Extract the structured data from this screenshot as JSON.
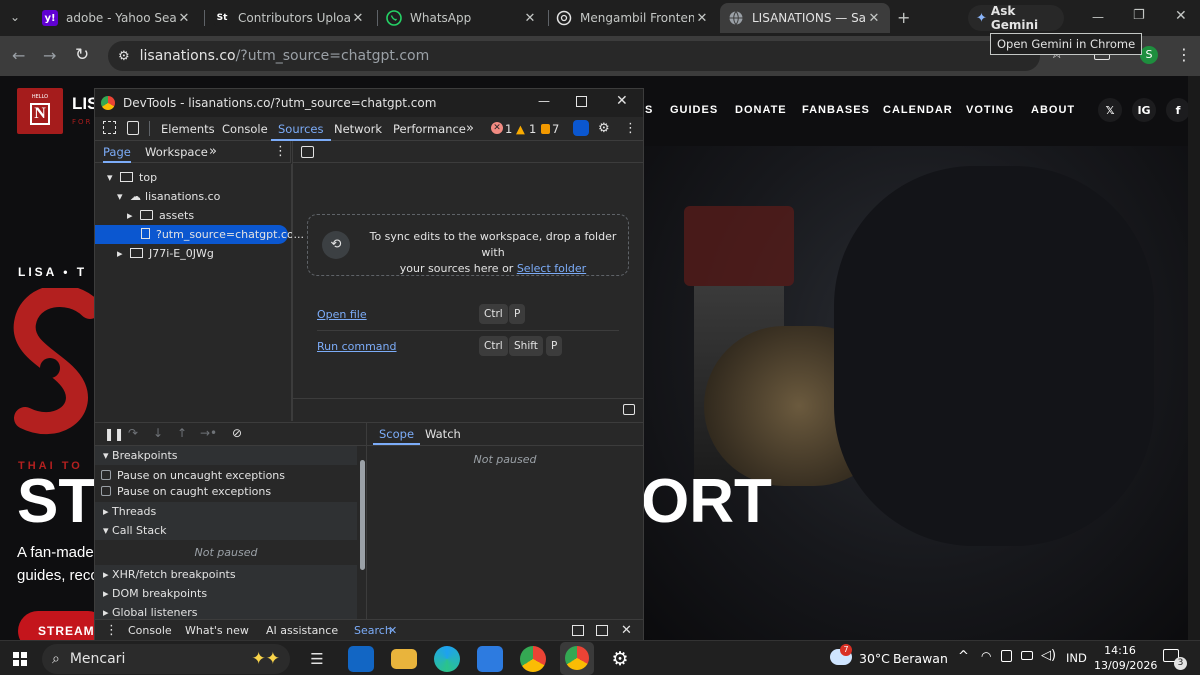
{
  "browser": {
    "tabs": [
      {
        "title": "adobe - Yahoo Search R",
        "favicon_text": "y!",
        "favicon_color": "#6001d2"
      },
      {
        "title": "Contributors Upload Fil",
        "favicon_text": "St",
        "favicon_color": "#1f1f1f"
      },
      {
        "title": "WhatsApp",
        "favicon_color": "#25d366"
      },
      {
        "title": "Mengambil Frontend Ke",
        "favicon_color": "#e3e3e3"
      },
      {
        "title": "LISANATIONS — SaWaD",
        "favicon_color": "#9aa0a6"
      }
    ],
    "ask_gemini": "Ask Gemini",
    "tooltip": "Open Gemini in Chrome",
    "url_host": "lisanations.co",
    "url_path": "/?utm_source=chatgpt.com",
    "profile_initial": "S"
  },
  "site": {
    "logo_small": "HELLO",
    "brand_partial": "LIS",
    "brand_sub_partial": "FOR",
    "nav": [
      "S",
      "GUIDES",
      "DONATE",
      "FANBASES",
      "CALENDAR",
      "VOTING",
      "ABOUT"
    ],
    "social": [
      "𝕏",
      "IG",
      "f"
    ],
    "kicker_partial": "LISA • T",
    "subkicker": "THAI TO",
    "headline_left": "ST",
    "headline_right": "ORT",
    "desc_line1": "A fan-made",
    "desc_line2": "guides, reco",
    "cta_partial": "STREAM"
  },
  "devtools": {
    "title": "DevTools - lisanations.co/?utm_source=chatgpt.com",
    "tabs": [
      "Elements",
      "Console",
      "Sources",
      "Network",
      "Performance"
    ],
    "active_tab": "Sources",
    "errors": "1",
    "warnings": "1",
    "issues": "7",
    "navigator_tabs": [
      "Page",
      "Workspace"
    ],
    "tree": [
      {
        "label": "top",
        "level": 0
      },
      {
        "label": "lisanations.co",
        "level": 1
      },
      {
        "label": "assets",
        "level": 2
      },
      {
        "label": "?utm_source=chatgpt.co...",
        "level": 3
      },
      {
        "label": "J77i-E_0JWg",
        "level": 1
      }
    ],
    "workspace_hint_1": "To sync edits to the workspace, drop a folder with",
    "workspace_hint_2": "your sources here or",
    "select_folder": "Select folder",
    "open_file": "Open file",
    "open_file_keys": [
      "Ctrl",
      "P"
    ],
    "run_command": "Run command",
    "run_command_keys": [
      "Ctrl",
      "Shift",
      "P"
    ],
    "scope_tabs": [
      "Scope",
      "Watch"
    ],
    "not_paused": "Not paused",
    "sections": {
      "breakpoints": "Breakpoints",
      "pause_uncaught": "Pause on uncaught exceptions",
      "pause_caught": "Pause on caught exceptions",
      "threads": "Threads",
      "call_stack": "Call Stack",
      "call_stack_status": "Not paused",
      "xhr": "XHR/fetch breakpoints",
      "dom": "DOM breakpoints",
      "global": "Global listeners"
    },
    "drawer": [
      "Console",
      "What's new",
      "AI assistance",
      "Search"
    ]
  },
  "taskbar": {
    "search": "Mencari",
    "weather_temp": "30°C",
    "weather_text": "Berawan",
    "weather_badge": "7",
    "lang": "IND",
    "time": "14:16",
    "date": "13/09/2026",
    "notif_count": "3"
  }
}
